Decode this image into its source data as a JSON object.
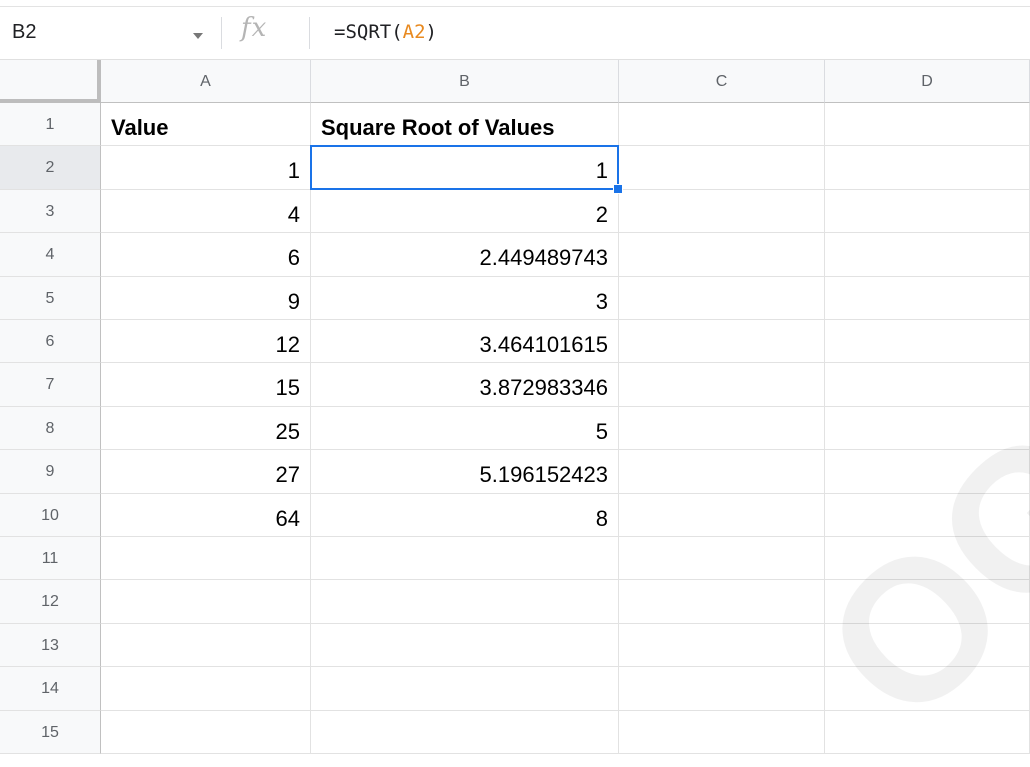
{
  "formula_bar": {
    "name_box": "B2",
    "fx_label": "fx",
    "formula_prefix": "=SQRT(",
    "formula_ref": "A2",
    "formula_suffix": ")"
  },
  "columns": [
    "A",
    "B",
    "C",
    "D"
  ],
  "rows": [
    "1",
    "2",
    "3",
    "4",
    "5",
    "6",
    "7",
    "8",
    "9",
    "10",
    "11",
    "12",
    "13",
    "14",
    "15"
  ],
  "cells": {
    "A1": "Value",
    "B1": "Square Root of Values",
    "A2": "1",
    "B2": "1",
    "A3": "4",
    "B3": "2",
    "A4": "6",
    "B4": "2.449489743",
    "A5": "9",
    "B5": "3",
    "A6": "12",
    "B6": "3.464101615",
    "A7": "15",
    "B7": "3.872983346",
    "A8": "25",
    "B8": "5",
    "A9": "27",
    "B9": "5.196152423",
    "A10": "64",
    "B10": "8"
  },
  "selection": {
    "cell": "B2",
    "color": "#1a73e8"
  },
  "colors": {
    "header_bg": "#f8f9fa",
    "grid_line": "#e2e2e2",
    "reference_color": "#e8891f"
  }
}
